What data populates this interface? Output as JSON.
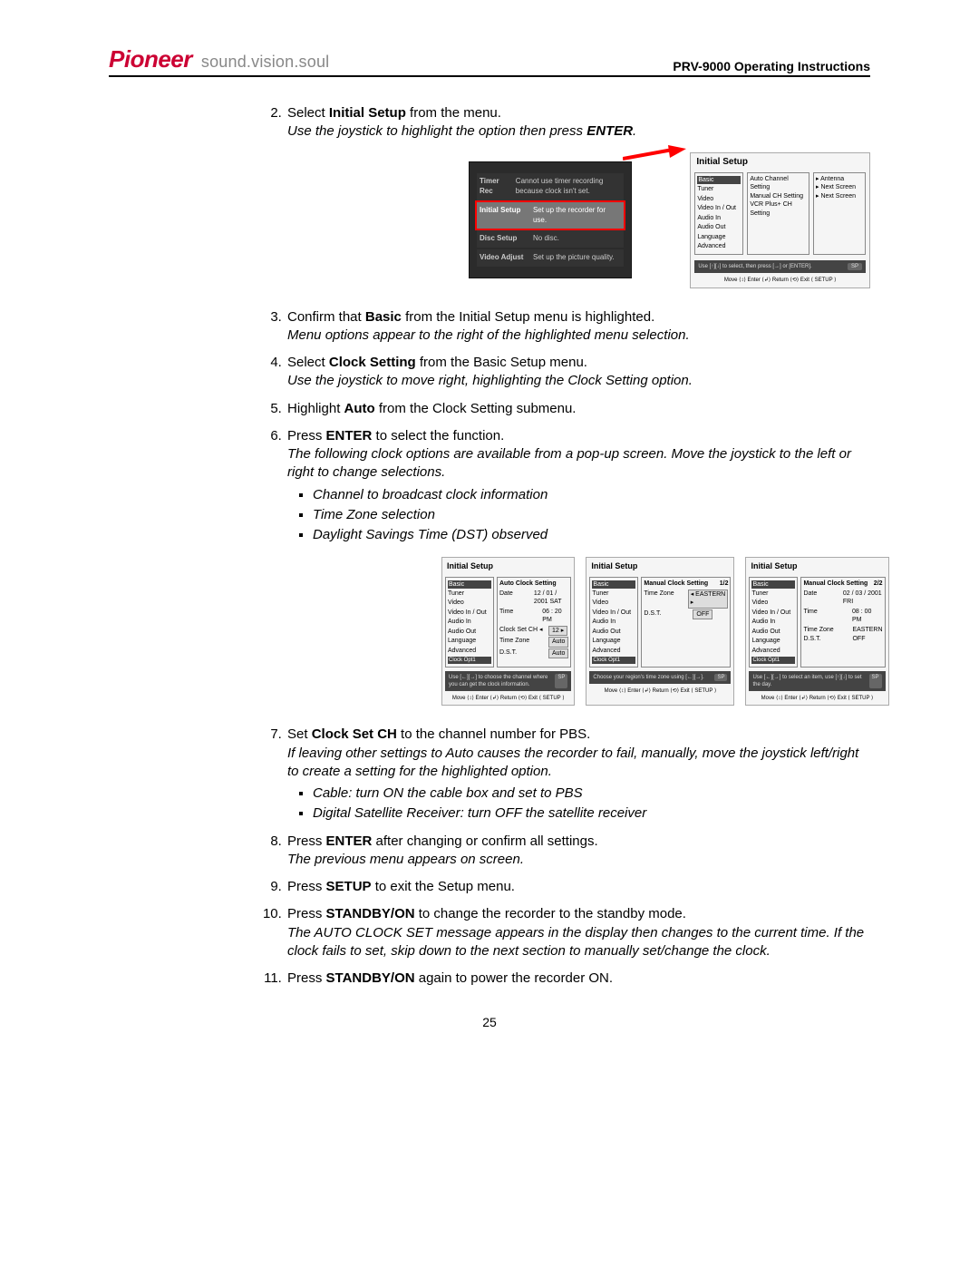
{
  "header": {
    "brand": "Pioneer",
    "tagline": "sound.vision.soul",
    "doc_title": "PRV-9000 Operating Instructions"
  },
  "steps": {
    "s2": {
      "pre": "Select ",
      "b": "Initial Setup",
      "post": " from the menu.",
      "it": "Use the joystick to highlight the option then press ",
      "itb": "ENTER",
      "it2": "."
    },
    "s3": {
      "pre": "Confirm that ",
      "b": "Basic",
      "post": " from the Initial Setup menu is highlighted.",
      "it": "Menu options appear to the right of the highlighted menu selection."
    },
    "s4": {
      "pre": "Select ",
      "b": "Clock Setting",
      "post": " from the Basic Setup menu.",
      "it": "Use the joystick to move right, highlighting the Clock Setting option."
    },
    "s5": {
      "pre": "Highlight ",
      "b": "Auto",
      "post": " from the Clock Setting submenu."
    },
    "s6": {
      "pre": "Press ",
      "b": "ENTER",
      "post": " to select the function.",
      "it": "The following clock options are available from a pop-up screen.  Move the joystick to the left or right to change selections.",
      "bul1": "Channel to broadcast clock information",
      "bul2": "Time Zone selection",
      "bul3": "Daylight Savings Time (DST) observed"
    },
    "s7": {
      "pre": "Set ",
      "b": "Clock Set CH",
      "post": " to the channel number for PBS.",
      "it": "If leaving other settings to Auto causes the recorder to fail, manually, move the joystick left/right to create a setting for the highlighted option.",
      "bul1": "Cable: turn ON the cable box and set to PBS",
      "bul2": "Digital Satellite Receiver: turn OFF the satellite receiver"
    },
    "s8": {
      "pre": "Press ",
      "b": "ENTER",
      "post": " after changing or confirm all settings.",
      "it": "The previous menu appears on screen."
    },
    "s9": {
      "pre": "Press ",
      "b": "SETUP",
      "post": " to exit the Setup menu."
    },
    "s10": {
      "pre": "Press ",
      "b": "STANDBY/ON",
      "post": " to change the recorder to the standby mode.",
      "it": "The AUTO CLOCK SET message appears in the display then changes to the current time.  If the clock fails to set, skip down to the next section to manually set/change the clock."
    },
    "s11": {
      "pre": "Press ",
      "b": "STANDBY/ON",
      "post": " again to power the recorder ON."
    }
  },
  "fig1": {
    "dark": {
      "r1l": "Timer Rec",
      "r1v": "Cannot use timer recording because clock isn't set.",
      "r2l": "Initial Setup",
      "r2v": "Set up the recorder for use.",
      "r3l": "Disc Setup",
      "r3v": "No disc.",
      "r4l": "Video Adjust",
      "r4v": "Set up the picture quality."
    },
    "light": {
      "title": "Initial Setup",
      "side": [
        "Basic",
        "Tuner",
        "Video",
        "Video In / Out",
        "Audio In",
        "Audio Out",
        "Language",
        "Advanced"
      ],
      "mid": [
        "Auto Channel Setting",
        "Manual CH Setting",
        "VCR Plus+ CH Setting"
      ],
      "right": [
        "▸ Antenna",
        "▸ Next Screen",
        "▸ Next Screen"
      ],
      "hint": "Use [↑][↓] to select, then press [→] or [ENTER].",
      "badge": "SP",
      "footer": "Move  ⟨↕⟩  Enter  ⟨↲⟩  Return  ⟨⟲⟩   Exit ⟨ SETUP ⟩"
    }
  },
  "fig2": {
    "a": {
      "title": "Initial Setup",
      "hdr": "Auto Clock Setting",
      "tab": "Clock Opt1",
      "rows": [
        [
          "Date",
          "12 / 01 / 2001  SAT"
        ],
        [
          "Time",
          "06 : 20 PM"
        ],
        [
          "Clock Set CH ◂",
          "12       ▸"
        ],
        [
          "Time Zone",
          "Auto"
        ],
        [
          "D.S.T.",
          "Auto"
        ]
      ],
      "hint": "Use [←][→] to choose the channel where you can get the clock information.",
      "badge": "SP",
      "footer": "Move  ⟨↕⟩  Enter  ⟨↲⟩  Return  ⟨⟲⟩   Exit ⟨ SETUP ⟩"
    },
    "b": {
      "title": "Initial Setup",
      "hdr": "Manual Clock Setting",
      "page": "1/2",
      "tab": "Clock Opt1",
      "rows": [
        [
          "Time Zone",
          "◂  EASTERN  ▸"
        ],
        [
          "D.S.T.",
          "OFF"
        ]
      ],
      "hint": "Choose your region's time zone using [←][→].",
      "badge": "SP",
      "footer": "Move  ⟨↕⟩  Enter  ⟨↲⟩  Return  ⟨⟲⟩   Exit ⟨ SETUP ⟩"
    },
    "c": {
      "title": "Initial Setup",
      "hdr": "Manual Clock Setting",
      "page": "2/2",
      "tab": "Clock Opt1",
      "rows": [
        [
          "Date",
          "02 / 03 / 2001  FRI"
        ],
        [
          "Time",
          "08 : 00 PM"
        ],
        [
          "Time Zone",
          "EASTERN"
        ],
        [
          "D.S.T.",
          "OFF"
        ]
      ],
      "hint": "Use [←][→] to select an item, use [↑][↓] to set the day.",
      "badge": "SP",
      "footer": "Move  ⟨↕⟩  Enter  ⟨↲⟩  Return  ⟨⟲⟩   Exit ⟨ SETUP ⟩"
    },
    "side": [
      "Basic",
      "Tuner",
      "Video",
      "Video In / Out",
      "Audio In",
      "Audio Out",
      "Language",
      "Advanced"
    ]
  },
  "page_number": "25"
}
